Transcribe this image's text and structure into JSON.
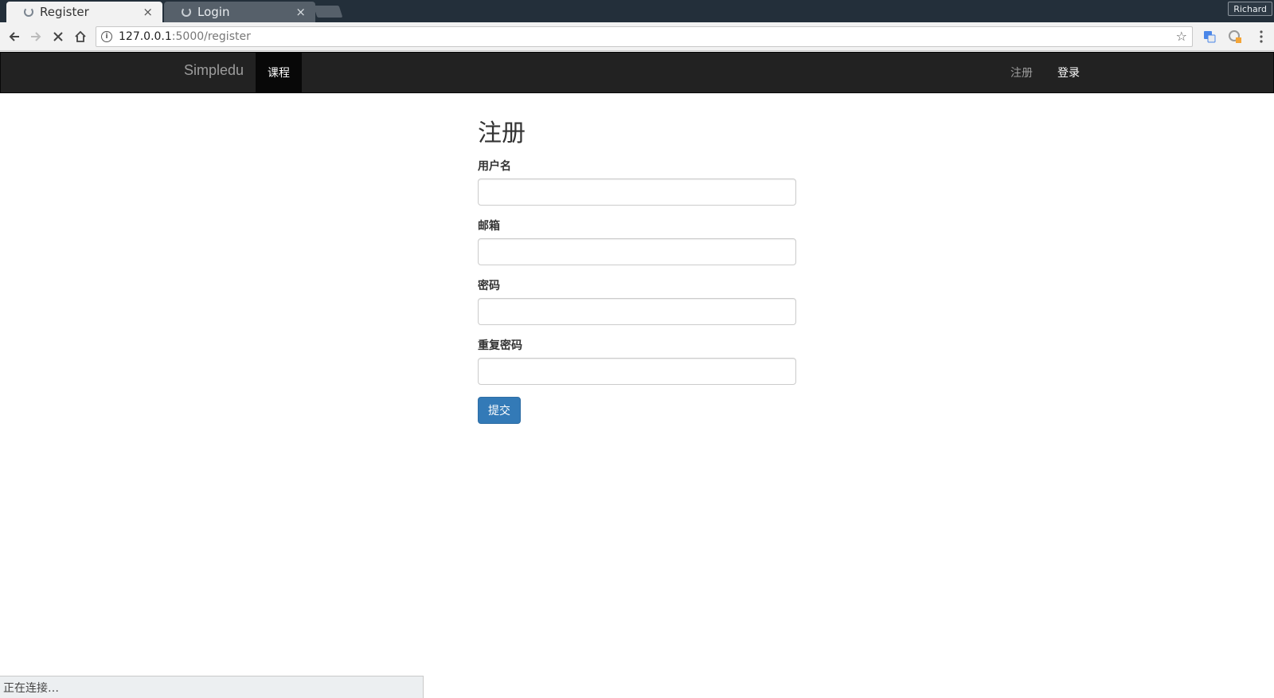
{
  "browser": {
    "tabs": [
      {
        "title": "Register",
        "close": "×"
      },
      {
        "title": "Login",
        "close": "×"
      }
    ],
    "profile_name": "Richard",
    "url_host": "127.0.0.1",
    "url_path": ":5000/register",
    "status_text": "正在连接…"
  },
  "navbar": {
    "brand": "Simpledu",
    "course": "课程",
    "register": "注册",
    "login": "登录"
  },
  "form": {
    "title": "注册",
    "fields": [
      {
        "label": "用户名",
        "value": ""
      },
      {
        "label": "邮箱",
        "value": ""
      },
      {
        "label": "密码",
        "value": ""
      },
      {
        "label": "重复密码",
        "value": ""
      }
    ],
    "submit": "提交"
  },
  "colors": {
    "primary": "#337ab7",
    "navbar_bg": "#222222",
    "tabstrip_bg": "#232f3a"
  }
}
